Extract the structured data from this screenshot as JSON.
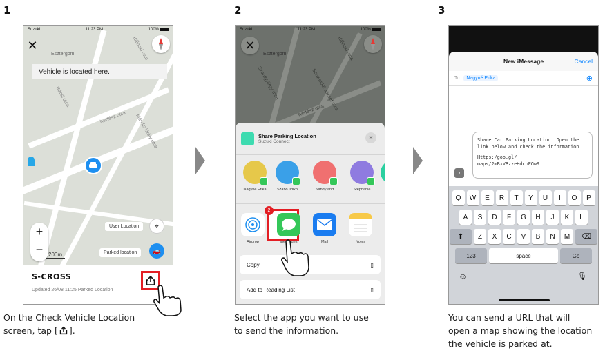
{
  "steps": [
    {
      "number": "1",
      "caption_line1": "On the Check Vehicle Location",
      "caption_line2": "screen, tap [",
      "caption_line2_end": "]."
    },
    {
      "number": "2",
      "caption_line1": "Select the app you want to use",
      "caption_line2": "to send the information."
    },
    {
      "number": "3",
      "caption_line1": "You can send a URL that will",
      "caption_line2": "open a map showing the location",
      "caption_line3": "the vehicle is parked at."
    }
  ],
  "status": {
    "carrier": "Suzuki",
    "time": "11:23 PM",
    "battery": "100%"
  },
  "map": {
    "place": "Esztergom",
    "streets": [
      "Kertész utca",
      "Rácsi utca",
      "Kálnoki utca",
      "Szentgyörgy utca",
      "Mátyás király utca",
      "Kertész utca",
      "Schweidel József utca"
    ],
    "banner": "Vehicle is located here.",
    "user_location_label": "User Location",
    "parked_location_label": "Parked location",
    "scale": "200m"
  },
  "vehicle": {
    "model": "S-CROSS",
    "updated": "Updated 26/08 11:25 Parked Location"
  },
  "share_sheet": {
    "title": "Share Parking Location",
    "subtitle": "Suzuki Connect",
    "contacts": [
      "Nagyné Erika",
      "Szabó Ildikó",
      "Sandy and",
      "Stephanie"
    ],
    "apps": [
      "Airdrop",
      "Messages",
      "Mail",
      "Notes",
      "Re"
    ],
    "badge": "2",
    "actions": [
      "Copy",
      "Add to Reading List"
    ]
  },
  "imessage": {
    "title": "New iMessage",
    "cancel": "Cancel",
    "to_label": "To:",
    "recipient": "Nagyné Erika",
    "message_line1": "Share Car Parking Location. Open the",
    "message_line2": "link below and check the information.",
    "url_line1": "Https:/goo.gl/",
    "url_line2": "maps/2mBxVBzzeHdcbFGw9"
  },
  "keyboard": {
    "row1": [
      "Q",
      "W",
      "E",
      "R",
      "T",
      "Y",
      "U",
      "I",
      "O",
      "P"
    ],
    "row2": [
      "A",
      "S",
      "D",
      "F",
      "G",
      "H",
      "J",
      "K",
      "L"
    ],
    "row3": [
      "Z",
      "X",
      "C",
      "V",
      "B",
      "N",
      "M"
    ],
    "numbers": "123",
    "space": "space",
    "go": "Go"
  },
  "colors": {
    "accent_blue": "#1d8ff0",
    "highlight_red": "#e31e24",
    "ios_blue": "#0a84ff",
    "messages_green": "#34c759"
  }
}
